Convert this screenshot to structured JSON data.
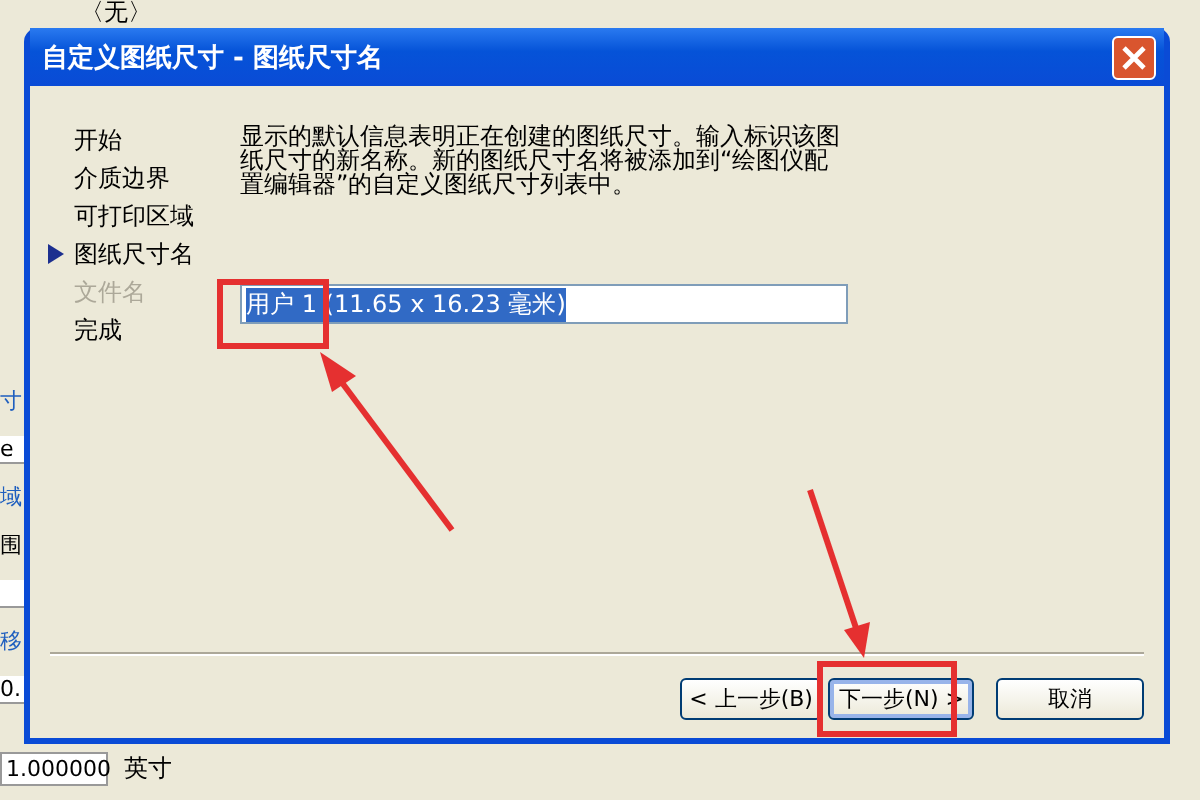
{
  "background": {
    "top_label": "〈无〉",
    "left_fragments": [
      {
        "text": "寸",
        "kind": "label"
      },
      {
        "text": "e",
        "kind": "field"
      },
      {
        "text": "域",
        "kind": "label"
      },
      {
        "text": "围",
        "kind": "text"
      },
      {
        "kind": "field"
      },
      {
        "text": "移",
        "kind": "label"
      },
      {
        "text": "0.",
        "kind": "field"
      }
    ],
    "scale_field": "1.000000",
    "unit": "英寸"
  },
  "window": {
    "title": "自定义图纸尺寸 - 图纸尺寸名"
  },
  "steps": [
    {
      "label": "开始",
      "selected": false,
      "disabled": false
    },
    {
      "label": "介质边界",
      "selected": false,
      "disabled": false
    },
    {
      "label": "可打印区域",
      "selected": false,
      "disabled": false
    },
    {
      "label": "图纸尺寸名",
      "selected": true,
      "disabled": false
    },
    {
      "label": "文件名",
      "selected": false,
      "disabled": true
    },
    {
      "label": "完成",
      "selected": false,
      "disabled": false
    }
  ],
  "description": "显示的默认信息表明正在创建的图纸尺寸。输入标识该图纸尺寸的新名称。新的图纸尺寸名将被添加到“绘图仪配置编辑器”的自定义图纸尺寸列表中。",
  "name_field": {
    "value": "用户 1 (11.65 x 16.23 毫米)",
    "selected": true
  },
  "buttons": [
    {
      "label": "< 上一步(B)",
      "focused": false
    },
    {
      "label": "下一步(N) >",
      "focused": true
    },
    {
      "label": "取消",
      "focused": false
    }
  ]
}
